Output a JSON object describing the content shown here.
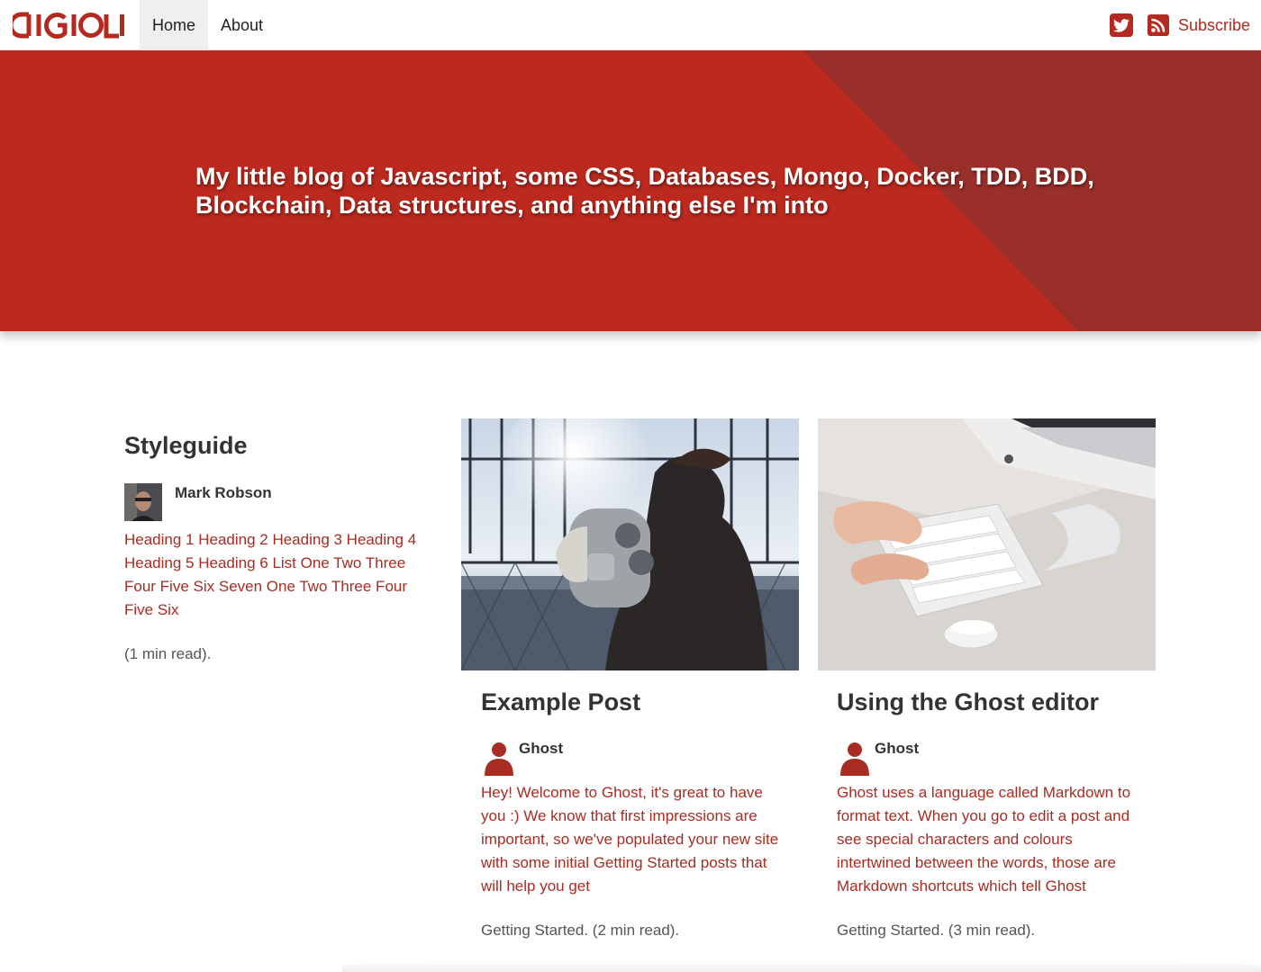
{
  "brand": {
    "logo_text": "DIGIOLI",
    "accent": "#b52a20",
    "hero_bg": "#bc291e",
    "hero_dark": "#9a2e2a"
  },
  "nav": {
    "items": [
      {
        "label": "Home",
        "active": true
      },
      {
        "label": "About",
        "active": false
      }
    ]
  },
  "header_right": {
    "twitter_icon": "twitter-icon",
    "rss_icon": "rss-icon",
    "subscribe_label": "Subscribe"
  },
  "hero": {
    "title": "My little blog of Javascript, some CSS, Databases, Mongo, Docker, TDD, BDD, Blockchain, Data structures, and anything else I'm into"
  },
  "posts": [
    {
      "title": "Styleguide",
      "author": "Mark Robson",
      "excerpt": "Heading 1 Heading 2 Heading 3 Heading 4 Heading 5 Heading 6 List One Two Three Four Five Six Seven One Two Three Four Five Six",
      "meta": "(1 min read)."
    },
    {
      "title": "Example Post",
      "author": "Ghost",
      "excerpt": "Hey! Welcome to Ghost, it's great to have you :) We know that first impressions are important, so we've populated your new site with some initial Getting Started posts that will help you get",
      "meta": "Getting Started. (2 min read)."
    },
    {
      "title": "Using the Ghost editor",
      "author": "Ghost",
      "excerpt": "Ghost uses a language called Markdown to format text. When you go to edit a post and see special characters and colours intertwined between the words, those are Markdown shortcuts which tell Ghost",
      "meta": "Getting Started. (3 min read)."
    }
  ]
}
